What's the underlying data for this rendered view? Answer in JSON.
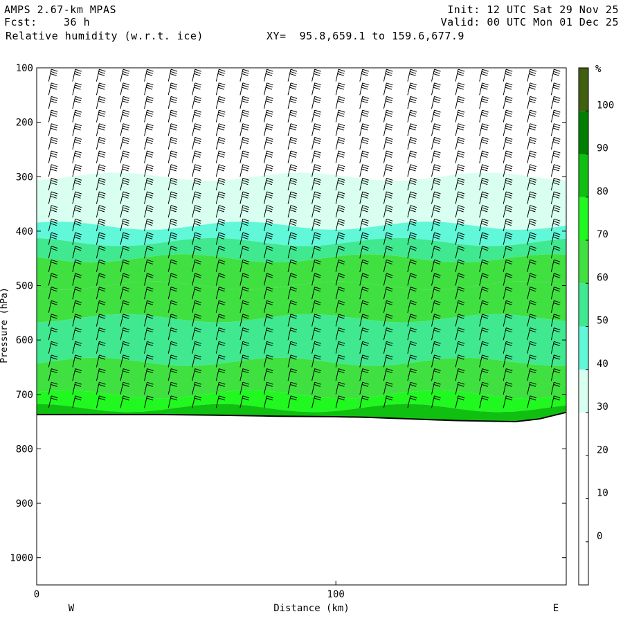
{
  "header": {
    "model": "AMPS 2.67-km MPAS",
    "fcst_label": "Fcst:",
    "fcst_value": "36 h",
    "field": "Relative humidity (w.r.t. ice)",
    "xy": "XY=  95.8,659.1 to 159.6,677.9",
    "init": "Init: 12 UTC Sat 29 Nov 25",
    "valid": "Valid: 00 UTC Mon 01 Dec 25"
  },
  "chart_data": {
    "type": "contour-filled cross-section with wind barbs",
    "title": "Relative humidity (w.r.t. ice)",
    "xlabel": "Distance (km)",
    "ylabel": "Pressure (hPa)",
    "x_range": [
      0,
      177
    ],
    "y_range": [
      1050,
      100
    ],
    "x_ticks": [
      0,
      100
    ],
    "y_ticks": [
      100,
      200,
      300,
      400,
      500,
      600,
      700,
      800,
      900,
      1000
    ],
    "x_end_labels": [
      "W",
      "E"
    ],
    "colorbar": {
      "unit": "%",
      "levels": [
        -10,
        0,
        10,
        20,
        30,
        40,
        50,
        60,
        70,
        80,
        90,
        100,
        110
      ],
      "tick_labels": [
        "0",
        "10",
        "20",
        "30",
        "40",
        "50",
        "60",
        "70",
        "80",
        "90",
        "100"
      ],
      "colors": [
        "#ffffff",
        "#ffffff",
        "#ffffff",
        "#ffffff",
        "#d8fff0",
        "#60f8d8",
        "#40e890",
        "#40e040",
        "#20f820",
        "#10c010",
        "#008000",
        "#406010"
      ]
    },
    "terrain_pressure": [
      {
        "x": 0,
        "p": 737
      },
      {
        "x": 40,
        "p": 737
      },
      {
        "x": 60,
        "p": 738
      },
      {
        "x": 80,
        "p": 740
      },
      {
        "x": 100,
        "p": 741
      },
      {
        "x": 110,
        "p": 742
      },
      {
        "x": 120,
        "p": 744
      },
      {
        "x": 140,
        "p": 748
      },
      {
        "x": 160,
        "p": 750
      },
      {
        "x": 168,
        "p": 745
      },
      {
        "x": 177,
        "p": 733
      }
    ],
    "rh_layers": [
      {
        "p_top": 100,
        "p_bot": 240,
        "rh": 5
      },
      {
        "p_top": 240,
        "p_bot": 300,
        "rh": 28
      },
      {
        "p_top": 300,
        "p_bot": 340,
        "rh": 38
      },
      {
        "p_top": 340,
        "p_bot": 390,
        "rh": 30
      },
      {
        "p_top": 390,
        "p_bot": 420,
        "rh": 45
      },
      {
        "p_top": 420,
        "p_bot": 450,
        "rh": 55
      },
      {
        "p_top": 450,
        "p_bot": 500,
        "rh": 68
      },
      {
        "p_top": 500,
        "p_bot": 560,
        "rh": 62
      },
      {
        "p_top": 560,
        "p_bot": 640,
        "rh": 58
      },
      {
        "p_top": 640,
        "p_bot": 700,
        "rh": 65
      },
      {
        "p_top": 700,
        "p_bot": 725,
        "rh": 75
      },
      {
        "p_top": 725,
        "p_bot": 760,
        "rh": 88
      }
    ],
    "barb_columns_x": [
      4,
      12,
      20,
      28,
      36,
      44,
      52,
      60,
      68,
      76,
      84,
      92,
      100,
      108,
      116,
      124,
      132,
      140,
      148,
      156,
      164,
      172
    ],
    "barb_levels_p": [
      125,
      150,
      175,
      200,
      225,
      250,
      275,
      300,
      325,
      350,
      375,
      400,
      425,
      450,
      475,
      500,
      525,
      550,
      575,
      600,
      625,
      650,
      675,
      700,
      725
    ]
  }
}
